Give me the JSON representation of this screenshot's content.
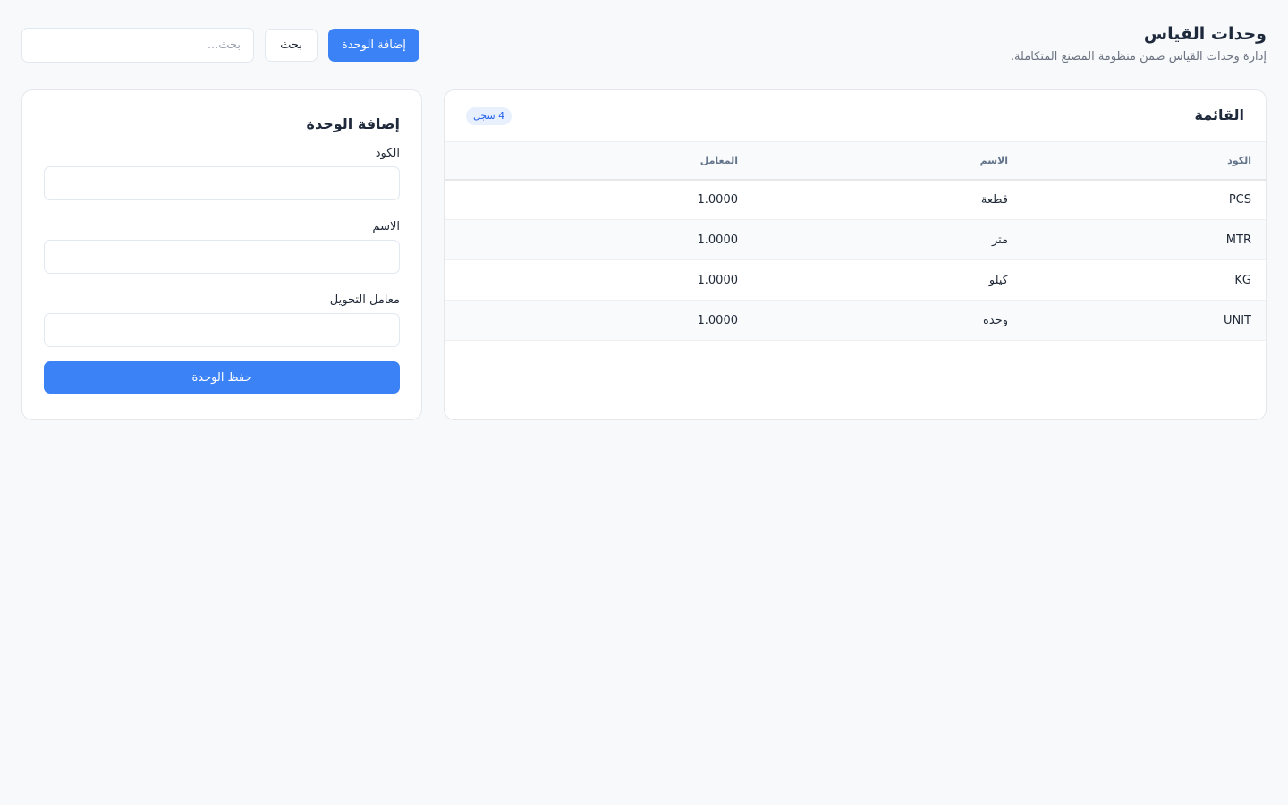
{
  "header": {
    "title": "وحدات القياس",
    "subtitle": "إدارة وحدات القياس ضمن منظومة المصنع المتكاملة.",
    "search_placeholder": "بحث...",
    "search_button": "بحث",
    "add_button": "إضافة الوحدة"
  },
  "list": {
    "title": "القائمة",
    "count_badge": "4 سجل",
    "columns": [
      "الكود",
      "الاسم",
      "المعامل"
    ],
    "rows": [
      {
        "code": "PCS",
        "name": "قطعة",
        "factor": "1.0000"
      },
      {
        "code": "MTR",
        "name": "متر",
        "factor": "1.0000"
      },
      {
        "code": "KG",
        "name": "كيلو",
        "factor": "1.0000"
      },
      {
        "code": "UNIT",
        "name": "وحدة",
        "factor": "1.0000"
      }
    ]
  },
  "form": {
    "title": "إضافة الوحدة",
    "code_label": "الكود",
    "name_label": "الاسم",
    "factor_label": "معامل التحويل",
    "save_button": "حفظ الوحدة"
  },
  "colors": {
    "primary": "#3b82f6",
    "background": "#f7f9fb",
    "badge_bg": "#e8f0fe"
  }
}
